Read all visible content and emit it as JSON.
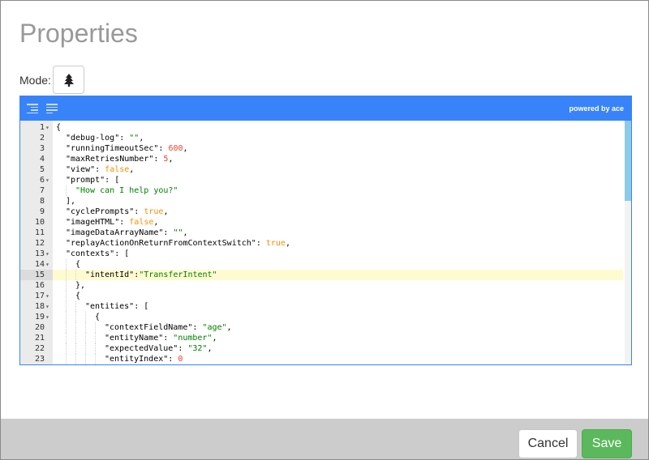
{
  "dialog": {
    "title": "Properties"
  },
  "mode": {
    "label": "Mode:",
    "icon": "tree-icon"
  },
  "editor": {
    "menu": {
      "format_icon": "format-icon",
      "compact_icon": "compact-icon",
      "powered_by": "powered by ace"
    },
    "active_line": 15,
    "lines": [
      {
        "n": "1",
        "fold": true,
        "indent": 0,
        "tokens": [
          [
            "k",
            "{"
          ]
        ]
      },
      {
        "n": "2",
        "fold": false,
        "indent": 1,
        "tokens": [
          [
            "k",
            "\"debug-log\""
          ],
          [
            "k",
            ": "
          ],
          [
            "s",
            "\"\""
          ],
          [
            "k",
            ","
          ]
        ]
      },
      {
        "n": "3",
        "fold": false,
        "indent": 1,
        "tokens": [
          [
            "k",
            "\"runningTimeoutSec\""
          ],
          [
            "k",
            ": "
          ],
          [
            "n",
            "600"
          ],
          [
            "k",
            ","
          ]
        ]
      },
      {
        "n": "4",
        "fold": false,
        "indent": 1,
        "tokens": [
          [
            "k",
            "\"maxRetriesNumber\""
          ],
          [
            "k",
            ": "
          ],
          [
            "n",
            "5"
          ],
          [
            "k",
            ","
          ]
        ]
      },
      {
        "n": "5",
        "fold": false,
        "indent": 1,
        "tokens": [
          [
            "k",
            "\"view\""
          ],
          [
            "k",
            ": "
          ],
          [
            "b",
            "false"
          ],
          [
            "k",
            ","
          ]
        ]
      },
      {
        "n": "6",
        "fold": true,
        "indent": 1,
        "tokens": [
          [
            "k",
            "\"prompt\""
          ],
          [
            "k",
            ": ["
          ]
        ]
      },
      {
        "n": "7",
        "fold": false,
        "indent": 2,
        "tokens": [
          [
            "s",
            "\"How can I help you?\""
          ]
        ]
      },
      {
        "n": "8",
        "fold": false,
        "indent": 1,
        "tokens": [
          [
            "k",
            "],"
          ]
        ]
      },
      {
        "n": "9",
        "fold": false,
        "indent": 1,
        "tokens": [
          [
            "k",
            "\"cyclePrompts\""
          ],
          [
            "k",
            ": "
          ],
          [
            "b",
            "true"
          ],
          [
            "k",
            ","
          ]
        ]
      },
      {
        "n": "10",
        "fold": false,
        "indent": 1,
        "tokens": [
          [
            "k",
            "\"imageHTML\""
          ],
          [
            "k",
            ": "
          ],
          [
            "b",
            "false"
          ],
          [
            "k",
            ","
          ]
        ]
      },
      {
        "n": "11",
        "fold": false,
        "indent": 1,
        "tokens": [
          [
            "k",
            "\"imageDataArrayName\""
          ],
          [
            "k",
            ": "
          ],
          [
            "s",
            "\"\""
          ],
          [
            "k",
            ","
          ]
        ]
      },
      {
        "n": "12",
        "fold": false,
        "indent": 1,
        "tokens": [
          [
            "k",
            "\"replayActionOnReturnFromContextSwitch\""
          ],
          [
            "k",
            ": "
          ],
          [
            "b",
            "true"
          ],
          [
            "k",
            ","
          ]
        ]
      },
      {
        "n": "13",
        "fold": true,
        "indent": 1,
        "tokens": [
          [
            "k",
            "\"contexts\""
          ],
          [
            "k",
            ": ["
          ]
        ]
      },
      {
        "n": "14",
        "fold": true,
        "indent": 2,
        "tokens": [
          [
            "k",
            "{"
          ]
        ]
      },
      {
        "n": "15",
        "fold": false,
        "indent": 3,
        "tokens": [
          [
            "k",
            "\"intentId\""
          ],
          [
            "k",
            ":"
          ],
          [
            "s",
            "\"TransferIntent\""
          ]
        ]
      },
      {
        "n": "16",
        "fold": false,
        "indent": 2,
        "tokens": [
          [
            "k",
            "},"
          ]
        ]
      },
      {
        "n": "17",
        "fold": true,
        "indent": 2,
        "tokens": [
          [
            "k",
            "{"
          ]
        ]
      },
      {
        "n": "18",
        "fold": true,
        "indent": 3,
        "tokens": [
          [
            "k",
            "\"entities\""
          ],
          [
            "k",
            ": ["
          ]
        ]
      },
      {
        "n": "19",
        "fold": true,
        "indent": 4,
        "tokens": [
          [
            "k",
            "{"
          ]
        ]
      },
      {
        "n": "20",
        "fold": false,
        "indent": 5,
        "tokens": [
          [
            "k",
            "\"contextFieldName\""
          ],
          [
            "k",
            ": "
          ],
          [
            "s",
            "\"age\""
          ],
          [
            "k",
            ","
          ]
        ]
      },
      {
        "n": "21",
        "fold": false,
        "indent": 5,
        "tokens": [
          [
            "k",
            "\"entityName\""
          ],
          [
            "k",
            ": "
          ],
          [
            "s",
            "\"number\""
          ],
          [
            "k",
            ","
          ]
        ]
      },
      {
        "n": "22",
        "fold": false,
        "indent": 5,
        "tokens": [
          [
            "k",
            "\"expectedValue\""
          ],
          [
            "k",
            ": "
          ],
          [
            "s",
            "\"32\""
          ],
          [
            "k",
            ","
          ]
        ]
      },
      {
        "n": "23",
        "fold": false,
        "indent": 5,
        "tokens": [
          [
            "k",
            "\"entityIndex\""
          ],
          [
            "k",
            ": "
          ],
          [
            "n",
            "0"
          ]
        ]
      }
    ]
  },
  "footer": {
    "cancel_label": "Cancel",
    "save_label": "Save"
  },
  "colors": {
    "accent": "#3883fa",
    "save": "#5cb85c",
    "footer_bg": "#cccccc",
    "title": "#999999"
  }
}
